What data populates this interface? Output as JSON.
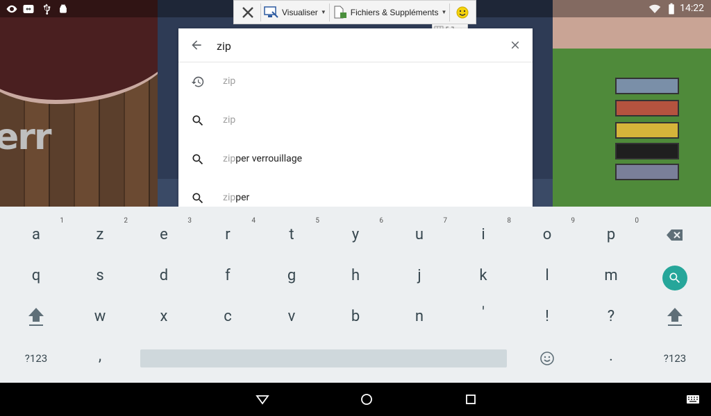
{
  "status": {
    "time": "14:22"
  },
  "toolbar": {
    "view_label": "Visualiser",
    "files_label": "Fichiers & Suppléments"
  },
  "search": {
    "query": "zip",
    "suggestions": [
      {
        "type": "history",
        "match": "zip",
        "rest": ""
      },
      {
        "type": "search",
        "match": "zip",
        "rest": ""
      },
      {
        "type": "search",
        "match": "zip",
        "rest": "per verrouillage"
      },
      {
        "type": "search",
        "match": "zip",
        "rest": "per"
      }
    ]
  },
  "keyboard": {
    "row1": [
      {
        "k": "a",
        "h": "1"
      },
      {
        "k": "z",
        "h": "2"
      },
      {
        "k": "e",
        "h": "3"
      },
      {
        "k": "r",
        "h": "4"
      },
      {
        "k": "t",
        "h": "5"
      },
      {
        "k": "y",
        "h": "6"
      },
      {
        "k": "u",
        "h": "7"
      },
      {
        "k": "i",
        "h": "8"
      },
      {
        "k": "o",
        "h": "9"
      },
      {
        "k": "p",
        "h": "0"
      }
    ],
    "row2": [
      "q",
      "s",
      "d",
      "f",
      "g",
      "h",
      "j",
      "k",
      "l",
      "m"
    ],
    "row3": [
      "w",
      "x",
      "c",
      "v",
      "b",
      "n",
      "'",
      "!",
      "?"
    ],
    "sym_label": "?123",
    "comma": ",",
    "period": "."
  },
  "colors": {
    "accent": "#26a69a"
  }
}
